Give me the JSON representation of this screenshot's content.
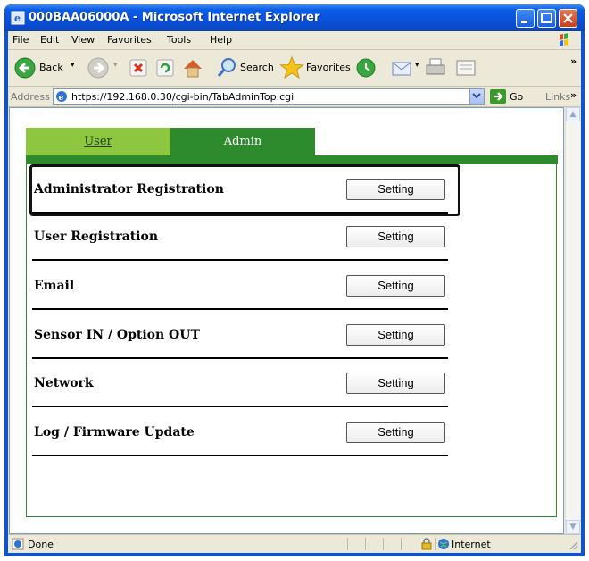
{
  "window": {
    "title": "000BAA06000A - Microsoft Internet Explorer"
  },
  "menu": {
    "items": [
      {
        "label": "File"
      },
      {
        "label": "Edit"
      },
      {
        "label": "View"
      },
      {
        "label": "Favorites"
      },
      {
        "label": "Tools"
      },
      {
        "label": "Help"
      }
    ]
  },
  "toolbar": {
    "back_label": "Back",
    "search_label": "Search",
    "favorites_label": "Favorites"
  },
  "address": {
    "label": "Address",
    "url": "https://192.168.0.30/cgi-bin/TabAdminTop.cgi",
    "go_label": "Go",
    "links_label": "Links"
  },
  "tabs": {
    "user_label": "User",
    "admin_label": "Admin"
  },
  "settings": {
    "rows": [
      {
        "label": "Administrator Registration",
        "button": "Setting"
      },
      {
        "label": "User Registration",
        "button": "Setting"
      },
      {
        "label": "Email",
        "button": "Setting"
      },
      {
        "label": "Sensor IN / Option OUT",
        "button": "Setting"
      },
      {
        "label": "Network",
        "button": "Setting"
      },
      {
        "label": "Log / Firmware Update",
        "button": "Setting"
      }
    ]
  },
  "status": {
    "text": "Done",
    "zone": "Internet"
  },
  "colors": {
    "tab_user": "#8dc63f",
    "tab_admin": "#2d8a2d",
    "titlebar": "#0a52dc"
  }
}
